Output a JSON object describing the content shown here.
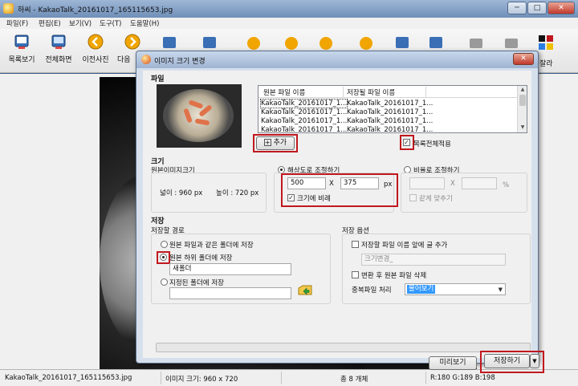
{
  "app": {
    "title": "하씨 - KakaoTalk_20161017_165115653.jpg",
    "min": "─",
    "max": "□",
    "close": "✕"
  },
  "menu": [
    "파일(F)",
    "편집(E)",
    "보기(V)",
    "도구(T)",
    "도움말(H)"
  ],
  "toolbar": {
    "list_view": "목록보기",
    "full_screen": "전체화면",
    "prev_photo": "이전사진",
    "next_photo": "다음",
    "trailing_label": "잘라"
  },
  "status": {
    "filename": "KakaoTalk_20161017_165115653.jpg",
    "image_size": "이미지 크기: 960 x 720",
    "total": "총 8 개체",
    "rgb": "R:180 G:189 B:198"
  },
  "dialog": {
    "title": "이미지 크기 변경",
    "close": "✕",
    "file_section": "파일",
    "file_table": {
      "headers": [
        "원본 파일 이름",
        "저장될 파일 이름"
      ],
      "rows": [
        [
          "KakaoTalk_20161017_1...",
          "KakaoTalk_20161017_1..."
        ],
        [
          "KakaoTalk_20161017_1...",
          "KakaoTalk_20161017_1..."
        ],
        [
          "KakaoTalk_20161017_1...",
          "KakaoTalk_20161017_1..."
        ],
        [
          "KakaoTalk_20161017_1...",
          "KakaoTalk_20161017_1..."
        ]
      ]
    },
    "add_button": "추가",
    "apply_all": "목록전체적용",
    "size_section": "크기",
    "original_size_label": "원본이미지크기",
    "width_text": "넓이 :  960 px",
    "height_text": "높이 : 720 px",
    "resolution_radio": "해상도로 조절하기",
    "width_value": "500",
    "x_label": "X",
    "height_value": "375",
    "px_unit": "px",
    "proportional": "크기에 비례",
    "ratio_radio": "비율로 조절하기",
    "percent_unit": "%",
    "equal_fit": "같게 맞추기",
    "save_section": "저장",
    "save_path_label": "저장할 경로",
    "same_folder": "원본 파일과 같은 폴더에 저장",
    "sub_folder": "원본 하위 폴더에 저장",
    "sub_folder_value": "새폴더",
    "specified_folder": "지정된 폴더에 저장",
    "save_options_label": "저장 옵션",
    "add_prefix": "저장할 파일 이름 앞에 글 추가",
    "prefix_value": "크기변경_",
    "delete_original": "변환 후 원본 파일 삭제",
    "duplicate_label": "중복파일 처리",
    "duplicate_value": "물어보기",
    "preview_button": "미리보기",
    "save_button": "저장하기",
    "save_dropdown": "▼"
  }
}
